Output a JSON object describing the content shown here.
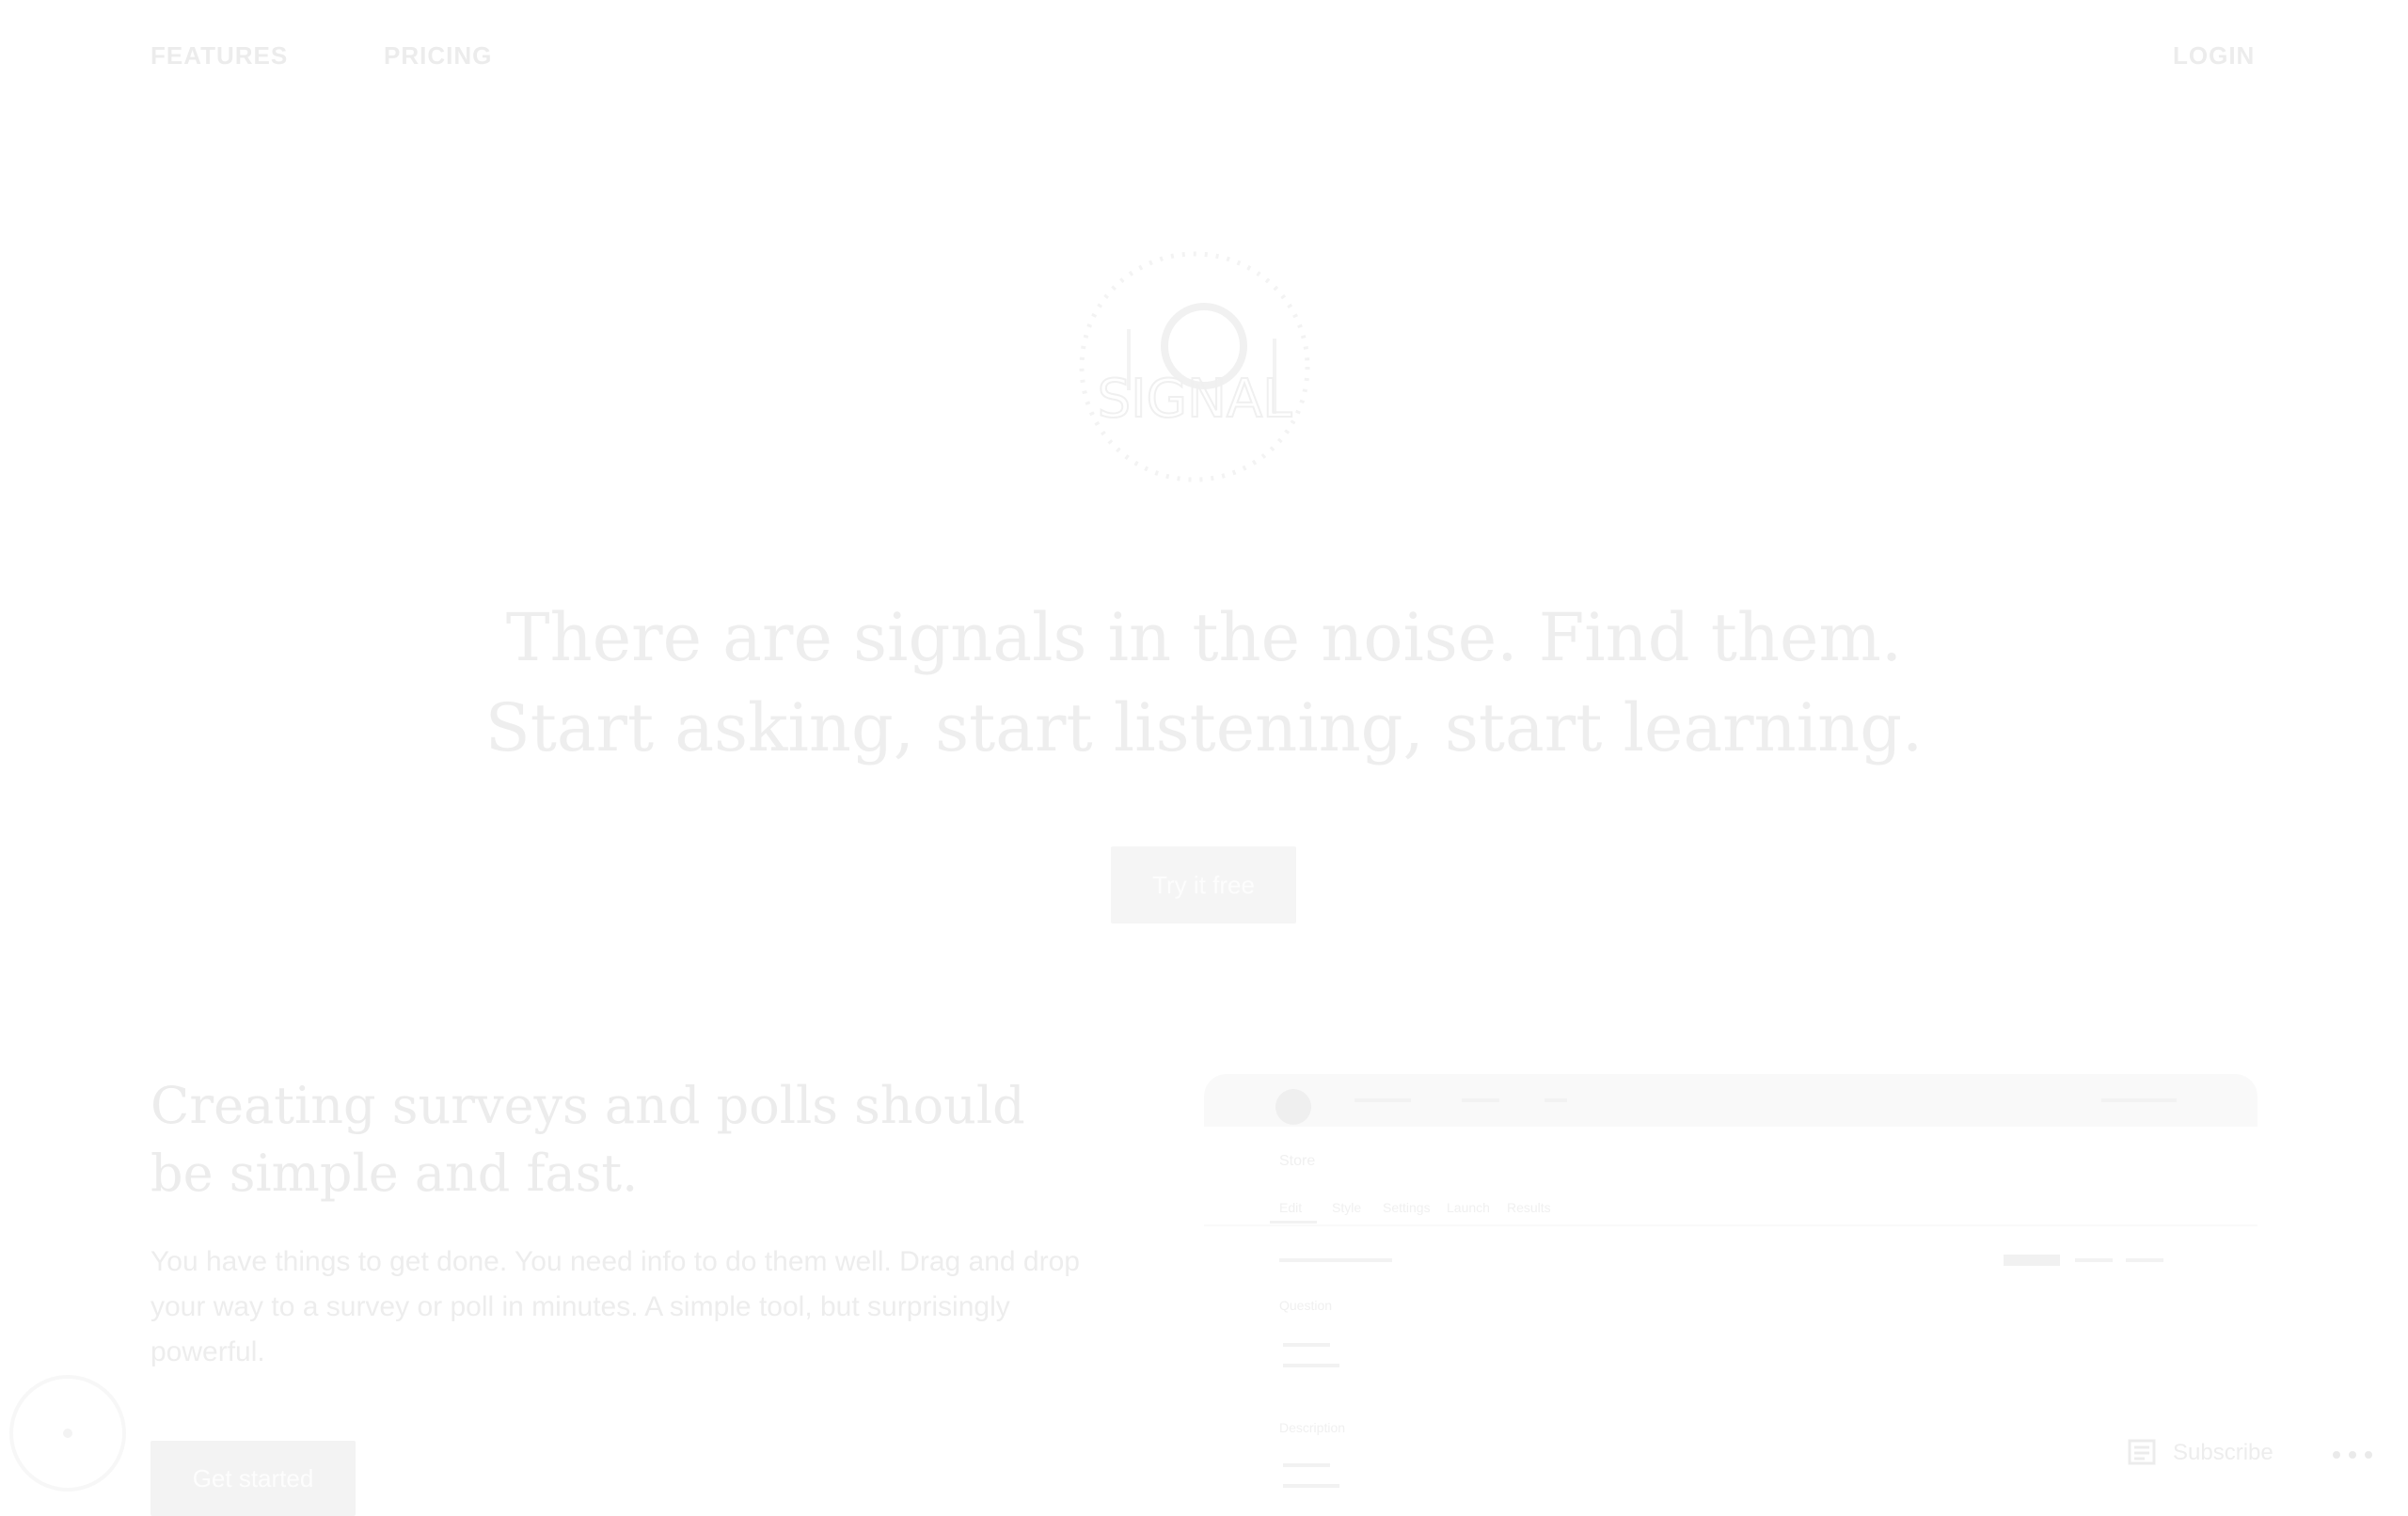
{
  "nav": {
    "features": "FEATURES",
    "pricing": "PRICING",
    "login": "LOGIN"
  },
  "logo": {
    "wordmark": "SIGNAL",
    "alt": "Signal logo"
  },
  "hero": {
    "line1": "There are signals in the noise. Find them.",
    "line2": "Start asking, start listening, start learning.",
    "cta": "Try it free"
  },
  "feature": {
    "heading": "Creating surveys and polls should be simple and fast.",
    "body": "You have things to get done. You need info to do them well. Drag and drop your way to a survey or poll in minutes. A simple tool, but surprisingly powerful.",
    "button": "Get started"
  },
  "mockup": {
    "page_title": "Store",
    "tabs": [
      "Edit",
      "Style",
      "Settings",
      "Launch",
      "Results"
    ],
    "section_label_1": "Question",
    "section_label_2": "Description"
  },
  "widgets": {
    "subscribe": "Subscribe"
  },
  "colors": {
    "text_faded": "#eeeeee",
    "button_bg": "#f5f5f5",
    "background": "#ffffff"
  }
}
